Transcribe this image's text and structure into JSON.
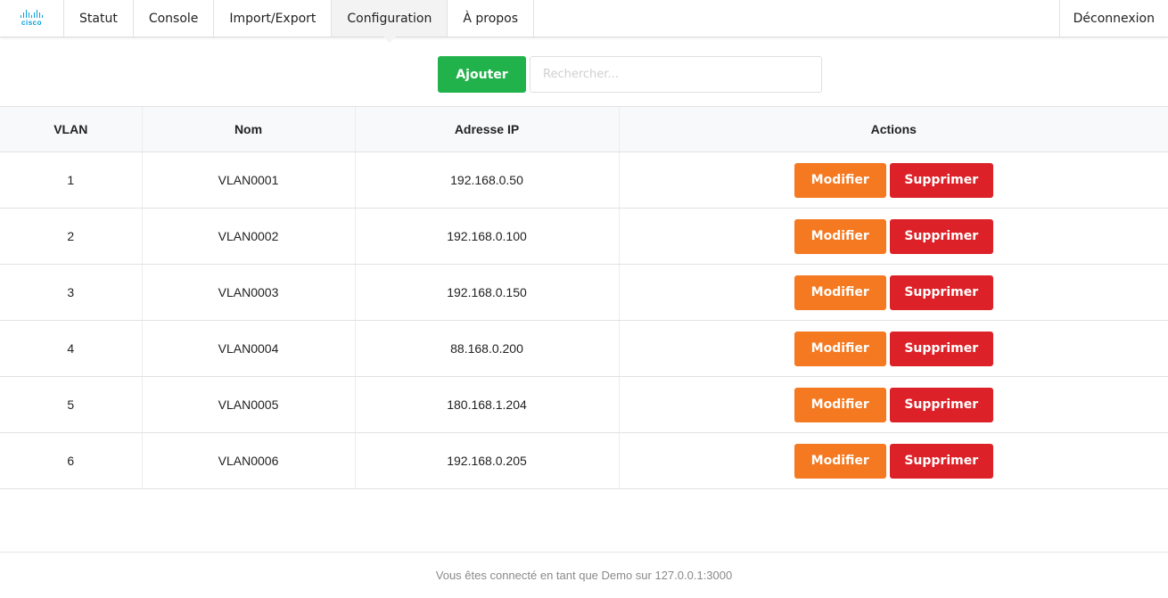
{
  "brand": {
    "logo_text": "cisco",
    "color": "#049fd9"
  },
  "nav": {
    "tabs": [
      {
        "label": "Statut"
      },
      {
        "label": "Console"
      },
      {
        "label": "Import/Export"
      },
      {
        "label": "Configuration",
        "active": true
      },
      {
        "label": "À propos"
      }
    ],
    "logout_label": "Déconnexion"
  },
  "toolbar": {
    "add_label": "Ajouter",
    "search_placeholder": "Rechercher...",
    "search_value": ""
  },
  "table": {
    "headers": [
      "VLAN",
      "Nom",
      "Adresse IP",
      "Actions"
    ],
    "rows": [
      {
        "vlan": "1",
        "name": "VLAN0001",
        "ip": "192.168.0.50"
      },
      {
        "vlan": "2",
        "name": "VLAN0002",
        "ip": "192.168.0.100"
      },
      {
        "vlan": "3",
        "name": "VLAN0003",
        "ip": "192.168.0.150"
      },
      {
        "vlan": "4",
        "name": "VLAN0004",
        "ip": "88.168.0.200"
      },
      {
        "vlan": "5",
        "name": "VLAN0005",
        "ip": "180.168.1.204"
      },
      {
        "vlan": "6",
        "name": "VLAN0006",
        "ip": "192.168.0.205"
      }
    ],
    "edit_label": "Modifier",
    "delete_label": "Supprimer"
  },
  "footer": {
    "text": "Vous êtes connecté en tant que Demo sur 127.0.0.1:3000"
  },
  "colors": {
    "add": "#22b24c",
    "edit": "#f47920",
    "delete": "#dc2228"
  }
}
